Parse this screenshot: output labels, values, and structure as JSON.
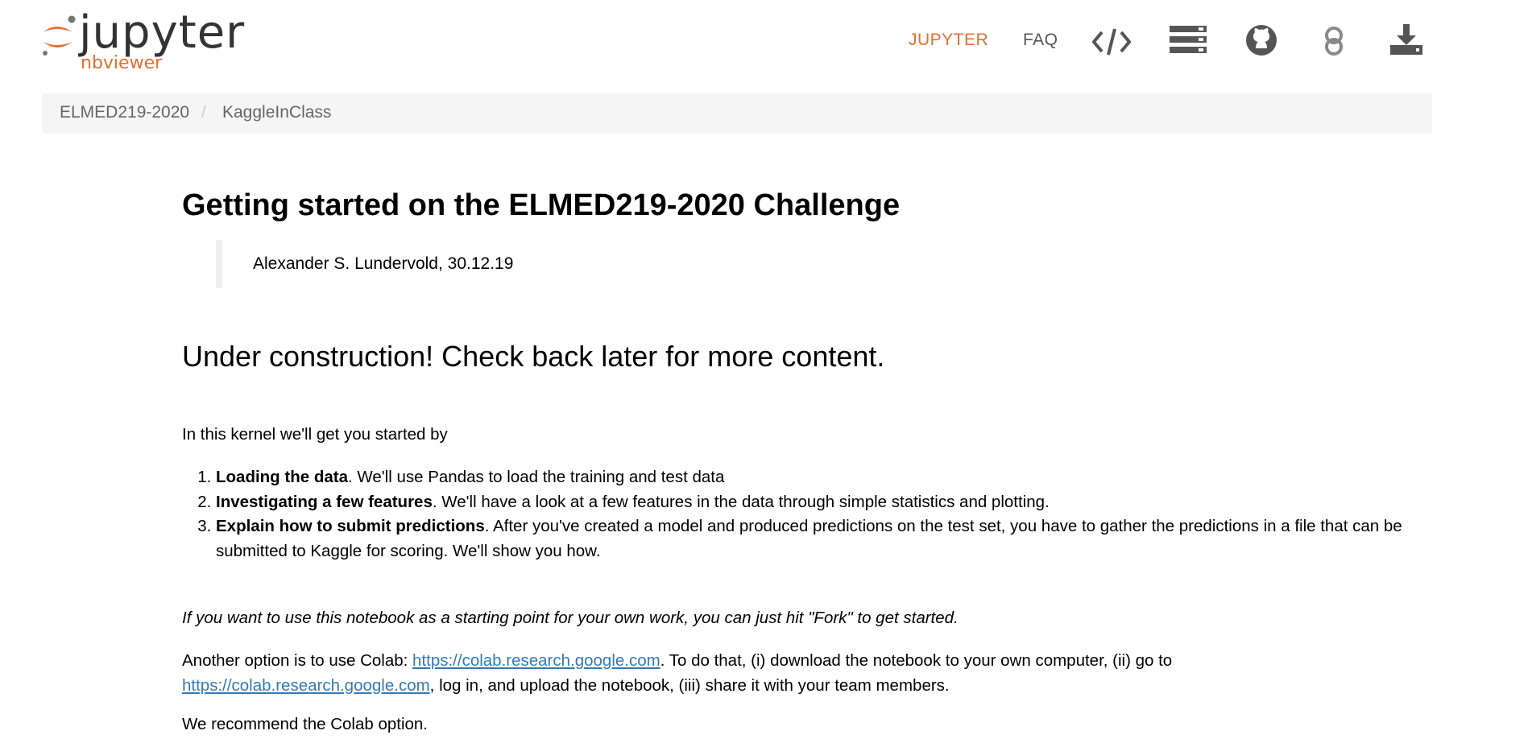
{
  "header": {
    "logo_word": "jupyter",
    "logo_sub": "nbviewer",
    "nav_jupyter": "JUPYTER",
    "nav_faq": "FAQ",
    "icons": [
      "code-icon",
      "server-icon",
      "github-icon",
      "binder-icon",
      "download-icon"
    ],
    "accent_color": "#e46e2e"
  },
  "breadcrumb": {
    "items": [
      "ELMED219-2020",
      "KaggleInClass"
    ],
    "separator": "/"
  },
  "notebook": {
    "title": "Getting started on the ELMED219-2020 Challenge",
    "author_line": "Alexander S. Lundervold, 30.12.19",
    "subtitle": "Under construction! Check back later for more content.",
    "intro": "In this kernel we'll get you started by",
    "steps": [
      {
        "bold": "Loading the data",
        "text": ". We'll use Pandas to load the training and test data"
      },
      {
        "bold": "Investigating a few features",
        "text": ". We'll have a look at a few features in the data through simple statistics and plotting."
      },
      {
        "bold": "Explain how to submit predictions",
        "text": ". After you've created a model and produced predictions on the test set, you have to gather the predictions in a file that can be submitted to Kaggle for scoring. We'll show you how."
      }
    ],
    "fork_note": "If you want to use this notebook as a starting point for your own work, you can just hit \"Fork\" to get started.",
    "colab_prefix": "Another option is to use Colab: ",
    "colab_link_1": "https://colab.research.google.com",
    "colab_middle": ". To do that, (i) download the notebook to your own computer, (ii) go to ",
    "colab_link_2": "https://colab.research.google.com",
    "colab_suffix": ", log in, and upload the notebook, (iii) share it with your team members.",
    "recommend": "We recommend the Colab option."
  }
}
